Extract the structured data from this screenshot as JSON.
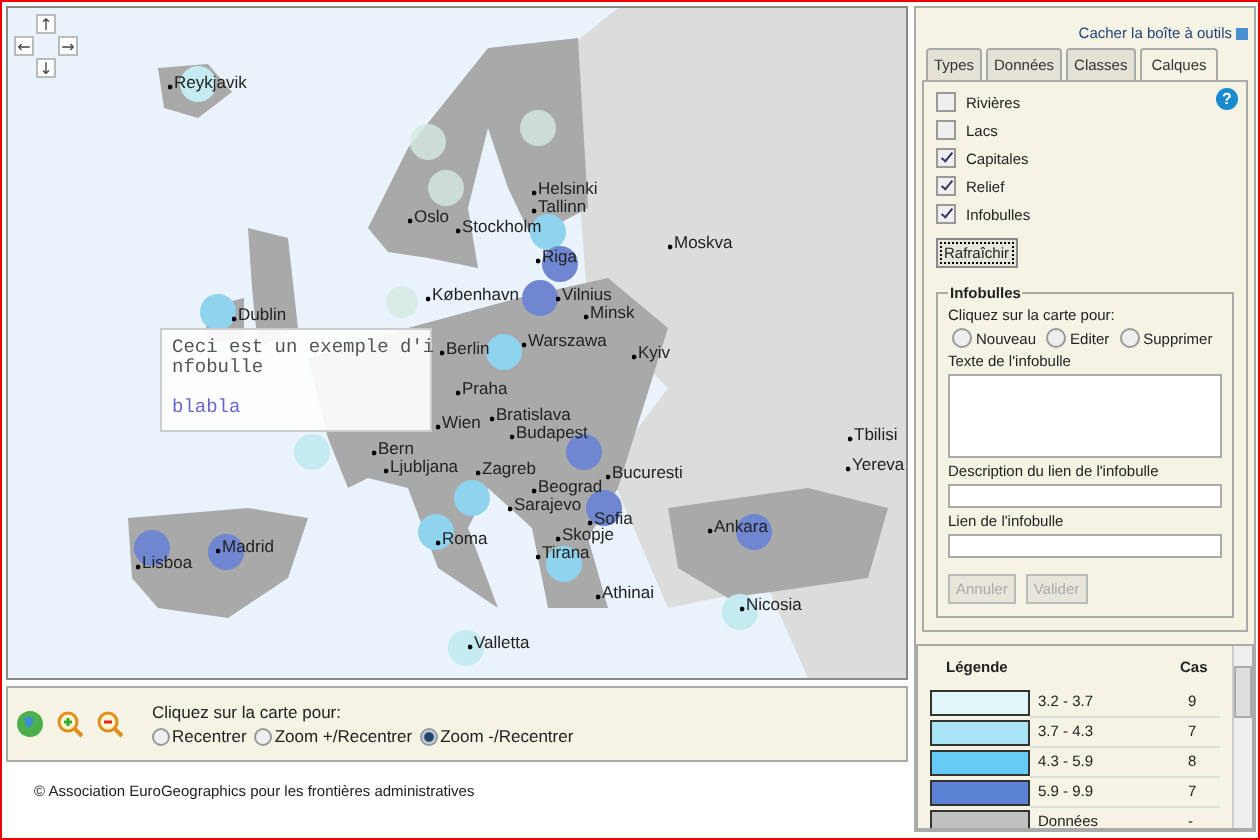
{
  "map": {
    "nav_buttons": [
      "↑",
      "←",
      "→",
      "↓"
    ],
    "cities": [
      {
        "name": "Reykjavik",
        "color": "#c4ebf2"
      },
      {
        "name": "Helsinki"
      },
      {
        "name": "Tallinn",
        "color": "#8fd3ef"
      },
      {
        "name": "Oslo"
      },
      {
        "name": "Stockholm"
      },
      {
        "name": "Moskva"
      },
      {
        "name": "Riga",
        "color": "#6f86d0"
      },
      {
        "name": "København"
      },
      {
        "name": "Vilnius",
        "color": "#6f86d0"
      },
      {
        "name": "Minsk"
      },
      {
        "name": "Dublin",
        "color": "#8fd3ef"
      },
      {
        "name": "Warszawa",
        "color": "#8fd3ef"
      },
      {
        "name": "Berlin"
      },
      {
        "name": "Kyiv"
      },
      {
        "name": "Praha"
      },
      {
        "name": "Bratislava"
      },
      {
        "name": "Wien"
      },
      {
        "name": "Budapest",
        "color": "#6f86d0"
      },
      {
        "name": "Tbilisi"
      },
      {
        "name": "Bern"
      },
      {
        "name": "Ljubljana"
      },
      {
        "name": "Zagreb",
        "color": "#8fd3ef"
      },
      {
        "name": "Yereva"
      },
      {
        "name": "Bucuresti"
      },
      {
        "name": "Beograd"
      },
      {
        "name": "Sarajevo"
      },
      {
        "name": "Sofia",
        "color": "#6f86d0"
      },
      {
        "name": "Ankara",
        "color": "#6f86d0"
      },
      {
        "name": "Roma",
        "color": "#8fd3ef"
      },
      {
        "name": "Skopje"
      },
      {
        "name": "Madrid",
        "color": "#6f86d0"
      },
      {
        "name": "Tirana",
        "color": "#8fd3ef"
      },
      {
        "name": "Lisboa",
        "color": "#6f86d0"
      },
      {
        "name": "Athinai"
      },
      {
        "name": "Nicosia",
        "color": "#c4ebf2"
      },
      {
        "name": "Valletta",
        "color": "#c4ebf2"
      }
    ],
    "tooltip": {
      "text": "Ceci est un exemple d'infobulle",
      "link": "blabla"
    }
  },
  "map_tools": {
    "prompt": "Cliquez sur la carte pour:",
    "options": [
      {
        "label": "Recentrer",
        "selected": false
      },
      {
        "label": "Zoom +/Recentrer",
        "selected": false
      },
      {
        "label": "Zoom -/Recentrer",
        "selected": true
      }
    ]
  },
  "copyright": "© Association EuroGeographics pour les frontières administratives",
  "toolbox": {
    "hide_link": "Cacher la boîte à outils",
    "tabs": [
      {
        "label": "Types",
        "selected": false
      },
      {
        "label": "Données",
        "selected": false
      },
      {
        "label": "Classes",
        "selected": false
      },
      {
        "label": "Calques",
        "selected": true
      }
    ],
    "help": "?",
    "layers": [
      {
        "label": "Rivières",
        "checked": false
      },
      {
        "label": "Lacs",
        "checked": false
      },
      {
        "label": "Capitales",
        "checked": true
      },
      {
        "label": "Relief",
        "checked": true
      },
      {
        "label": "Infobulles",
        "checked": true
      }
    ],
    "refresh_button": "Rafraîchir",
    "infobulles": {
      "title": "Infobulles",
      "prompt": "Cliquez sur la carte pour:",
      "modes": [
        {
          "label": "Nouveau",
          "selected": false
        },
        {
          "label": "Editer",
          "selected": false
        },
        {
          "label": "Supprimer",
          "selected": false
        }
      ],
      "text_label": "Texte de l'infobulle",
      "link_desc_label": "Description du lien de l'infobulle",
      "link_label": "Lien de l'infobulle",
      "buttons": [
        {
          "label": "Annuler",
          "disabled": true
        },
        {
          "label": "Valider",
          "disabled": true
        }
      ]
    }
  },
  "legend": {
    "columns": [
      "Légende",
      "Cas"
    ],
    "rows": [
      {
        "range": "3.2 - 3.7",
        "count": "9",
        "color": "#e0f6f8"
      },
      {
        "range": "3.7 - 4.3",
        "count": "7",
        "color": "#a8e4f5"
      },
      {
        "range": "4.3 - 5.9",
        "count": "8",
        "color": "#66ccf5"
      },
      {
        "range": "5.9 - 9.9",
        "count": "7",
        "color": "#5b82d5"
      },
      {
        "range": "Données",
        "count": "-",
        "color": "#c0c0c0"
      }
    ]
  }
}
